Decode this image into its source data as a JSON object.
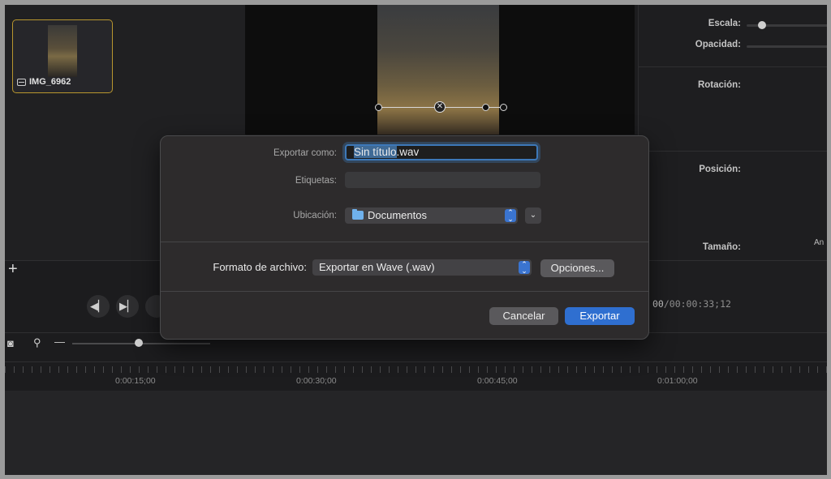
{
  "media_bin": {
    "clip_name": "IMG_6962"
  },
  "properties": {
    "scale_label": "Escala:",
    "opacity_label": "Opacidad:",
    "rotation_label": "Rotación:",
    "position_label": "Posición:",
    "size_label": "Tamaño:",
    "size_extra": "An"
  },
  "playback": {
    "timecode_current": "00",
    "timecode_total": "/00:00:33;12"
  },
  "timeline": {
    "ruler_labels": [
      "0:00:15;00",
      "0:00:30;00",
      "0:00:45;00",
      "0:01:00;00"
    ]
  },
  "dialog": {
    "export_as_label": "Exportar como:",
    "filename_selected": "Sin título",
    "filename_ext": ".wav",
    "tags_label": "Etiquetas:",
    "location_label": "Ubicación:",
    "location_value": "Documentos",
    "format_label": "Formato de archivo:",
    "format_value": "Exportar en Wave (.wav)",
    "options_button": "Opciones...",
    "cancel_button": "Cancelar",
    "export_button": "Exportar",
    "accent_color": "#2f6fd0"
  },
  "icons": [
    "film-icon",
    "plus-icon",
    "skip-back-icon",
    "play-pause-icon",
    "camera-icon",
    "magnify-icon",
    "minus-icon",
    "folder-icon",
    "chevron-updown-icon",
    "chevron-down-icon"
  ]
}
